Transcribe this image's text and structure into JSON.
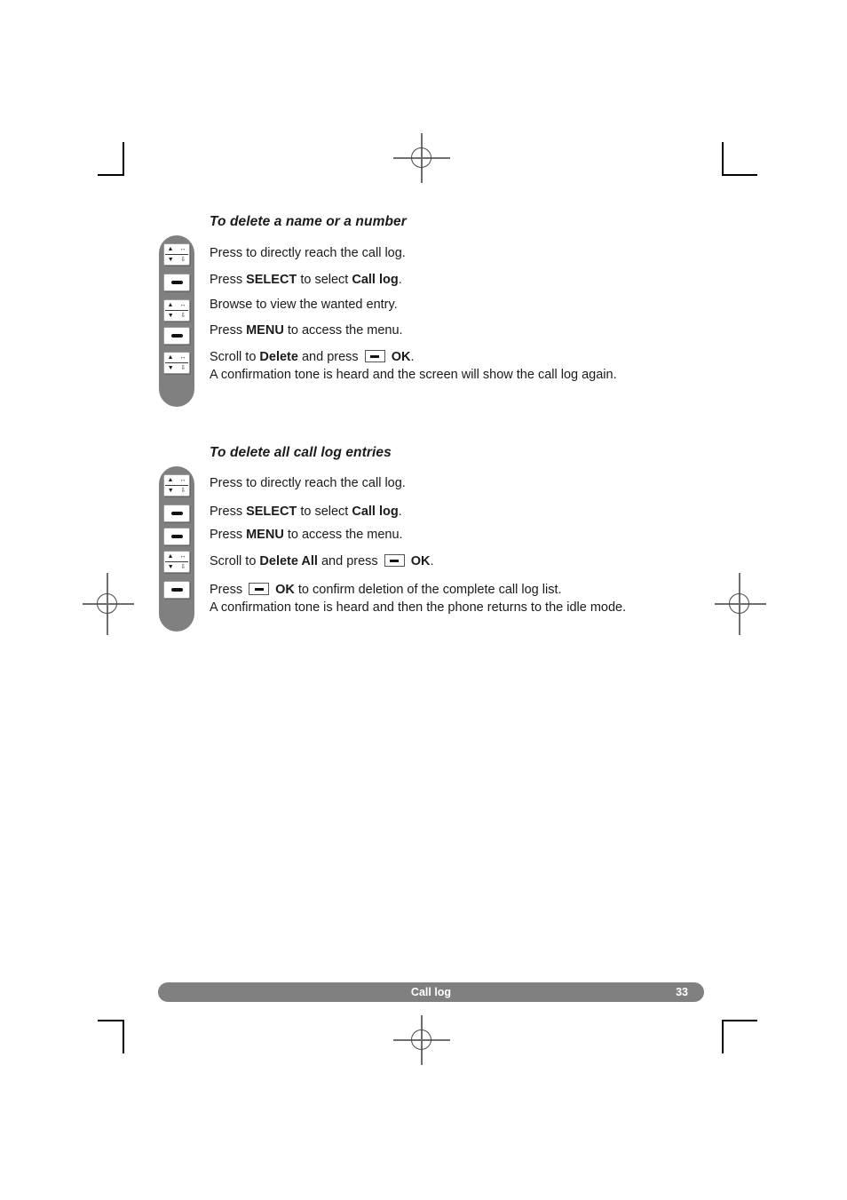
{
  "colors": {
    "gray_bar": "#808080",
    "text": "#1a1a1a",
    "footer_text": "#ffffff"
  },
  "icons": {
    "nav_key": "navigation-key-icon",
    "soft_key": "soft-key-icon",
    "inline_soft_key": "inline-soft-key-icon",
    "nav_glyph_top_left": "▲",
    "nav_glyph_top_right": "↔",
    "nav_glyph_bottom_left": "▼",
    "nav_glyph_bottom_right": "⇩",
    "crop_mark": "crop-mark",
    "registration_mark": "registration-mark"
  },
  "sections": [
    {
      "heading": "To delete a name or a number",
      "steps": [
        {
          "icon": "nav_key",
          "lines": [
            {
              "parts": [
                {
                  "t": "Press to directly reach the call log.",
                  "bold": false
                }
              ]
            }
          ]
        },
        {
          "icon": "soft_key",
          "lines": [
            {
              "parts": [
                {
                  "t": "Press ",
                  "bold": false
                },
                {
                  "t": "SELECT",
                  "bold": true
                },
                {
                  "t": " to select ",
                  "bold": false
                },
                {
                  "t": "Call log",
                  "bold": true
                },
                {
                  "t": ".",
                  "bold": false
                }
              ]
            }
          ]
        },
        {
          "icon": "nav_key",
          "lines": [
            {
              "parts": [
                {
                  "t": "Browse to view the wanted entry.",
                  "bold": false
                }
              ]
            }
          ]
        },
        {
          "icon": "soft_key",
          "lines": [
            {
              "parts": [
                {
                  "t": "Press ",
                  "bold": false
                },
                {
                  "t": "MENU",
                  "bold": true
                },
                {
                  "t": " to access the menu.",
                  "bold": false
                }
              ]
            }
          ]
        },
        {
          "icon": "nav_key",
          "lines": [
            {
              "parts": [
                {
                  "t": "Scroll to ",
                  "bold": false
                },
                {
                  "t": "Delete",
                  "bold": true
                },
                {
                  "t": " and press ",
                  "bold": false
                },
                {
                  "key": true
                },
                {
                  "t": " ",
                  "bold": false
                },
                {
                  "t": "OK",
                  "bold": true
                },
                {
                  "t": ".",
                  "bold": false
                }
              ]
            },
            {
              "parts": [
                {
                  "t": "A confirmation tone is heard and the screen will show the call log again.",
                  "bold": false
                }
              ]
            }
          ]
        }
      ]
    },
    {
      "heading": "To delete all call log entries",
      "steps": [
        {
          "icon": "nav_key",
          "lines": [
            {
              "parts": [
                {
                  "t": "Press to directly reach the call log.",
                  "bold": false
                }
              ]
            }
          ]
        },
        {
          "icon": "soft_key",
          "lines": [
            {
              "parts": [
                {
                  "t": "Press ",
                  "bold": false
                },
                {
                  "t": "SELECT",
                  "bold": true
                },
                {
                  "t": " to select ",
                  "bold": false
                },
                {
                  "t": "Call log",
                  "bold": true
                },
                {
                  "t": ".",
                  "bold": false
                }
              ]
            }
          ]
        },
        {
          "icon": "soft_key",
          "lines": [
            {
              "parts": [
                {
                  "t": "Press ",
                  "bold": false
                },
                {
                  "t": "MENU",
                  "bold": true
                },
                {
                  "t": " to access the menu.",
                  "bold": false
                }
              ]
            }
          ]
        },
        {
          "icon": "nav_key",
          "lines": [
            {
              "parts": [
                {
                  "t": "Scroll to ",
                  "bold": false
                },
                {
                  "t": "Delete All",
                  "bold": true
                },
                {
                  "t": " and press ",
                  "bold": false
                },
                {
                  "key": true
                },
                {
                  "t": " ",
                  "bold": false
                },
                {
                  "t": "OK",
                  "bold": true
                },
                {
                  "t": ".",
                  "bold": false
                }
              ]
            }
          ]
        },
        {
          "icon": "soft_key",
          "lines": [
            {
              "parts": [
                {
                  "t": "Press ",
                  "bold": false
                },
                {
                  "key": true
                },
                {
                  "t": " ",
                  "bold": false
                },
                {
                  "t": "OK",
                  "bold": true
                },
                {
                  "t": " to confirm deletion of the complete call log list.",
                  "bold": false
                }
              ]
            },
            {
              "parts": [
                {
                  "t": "A confirmation tone is heard and then the phone returns to the idle mode.",
                  "bold": false
                }
              ]
            }
          ]
        }
      ]
    }
  ],
  "footer": {
    "title": "Call log",
    "page_number": "33"
  }
}
